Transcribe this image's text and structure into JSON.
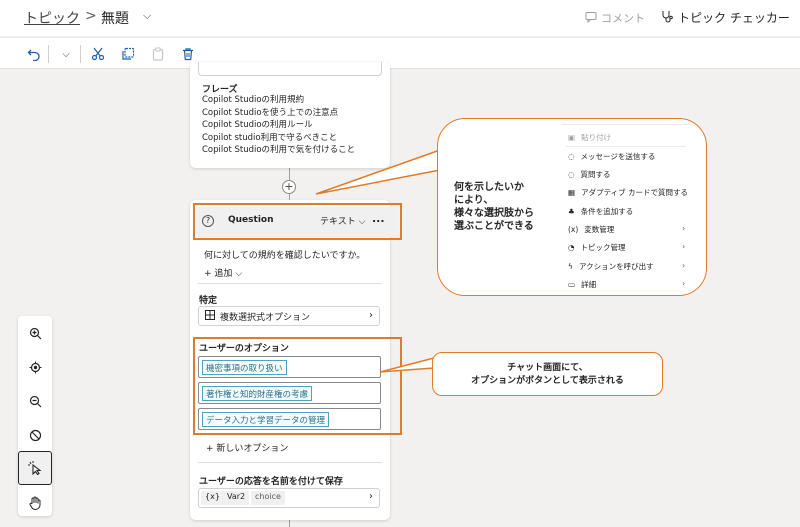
{
  "header": {
    "breadcrumb_root": "トピック",
    "breadcrumb_sep": ">",
    "topic_title": "無題",
    "comment_label": "コメント",
    "checker_label": "トピック チェッカー"
  },
  "phrases": {
    "title": "フレーズ",
    "items": [
      "Copilot Studioの利用規約",
      "Copilot Studioを使う上での注意点",
      "Copilot Studioの利用ルール",
      "Copilot studio利用で守るべきこと",
      "Copilot Studioの利用で気を付けること"
    ]
  },
  "question": {
    "title": "Question",
    "type_label": "テキスト",
    "more": "...",
    "text": "何に対しての規約を確認したいですか。",
    "add_label": "追加",
    "identify_label": "特定",
    "identify_value": "複数選択式オプション",
    "options_label": "ユーザーのオプション",
    "options": [
      "機密事項の取り扱い",
      "著作権と知的財産権の考慮",
      "データ入力と学習データの管理"
    ],
    "new_option": "新しいオプション",
    "save_label": "ユーザーの応答を名前を付けて保存",
    "var_icon": "{x}",
    "var_name": "Var2",
    "var_type": "choice"
  },
  "callout_top": {
    "lines": [
      "何を示したいか",
      "により、",
      "様々な選択肢から",
      "選ぶことができる"
    ]
  },
  "callout_bottom": {
    "lines": [
      "チャット画面にて、",
      "オプションがボタンとして表示される"
    ]
  },
  "menu": {
    "items": [
      {
        "label": "貼り付け",
        "icon": "paste-icon",
        "disabled": true,
        "has_sub": false
      },
      {
        "label": "メッセージを送信する",
        "icon": "message-icon",
        "has_sub": false
      },
      {
        "label": "質問する",
        "icon": "question-icon",
        "has_sub": false
      },
      {
        "label": "アダプティブ カードで質問する",
        "icon": "card-icon",
        "has_sub": false
      },
      {
        "label": "条件を追加する",
        "icon": "condition-icon",
        "has_sub": false
      },
      {
        "label": "変数管理",
        "icon": "variable-icon",
        "has_sub": true
      },
      {
        "label": "トピック管理",
        "icon": "topic-icon",
        "has_sub": true
      },
      {
        "label": "アクションを呼び出す",
        "icon": "action-icon",
        "has_sub": true
      },
      {
        "label": "詳細",
        "icon": "more-icon",
        "has_sub": true
      }
    ]
  },
  "colors": {
    "accent_orange": "#e07b28",
    "chip_blue": "#2c6f8b",
    "link_blue": "#1a5fa8"
  }
}
